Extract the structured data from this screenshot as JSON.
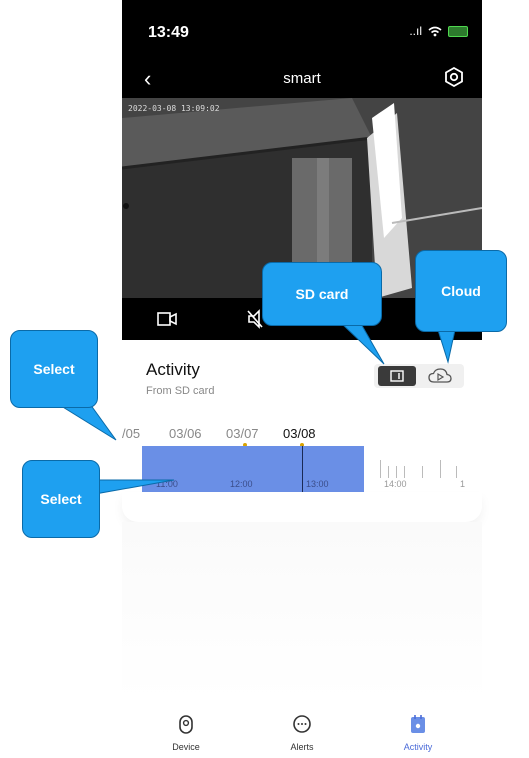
{
  "status_bar": {
    "time": "13:49",
    "signal": "..ıl"
  },
  "nav": {
    "title": "smart"
  },
  "video": {
    "timestamp": "2022-03-08 13:09:02"
  },
  "activity": {
    "title": "Activity",
    "subtitle": "From SD card"
  },
  "dates": [
    "/05",
    "03/06",
    "03/07",
    "03/08"
  ],
  "timeline": {
    "labels": [
      "11:00",
      "12:00",
      "13:00",
      "14:00",
      "1"
    ]
  },
  "tabs": [
    {
      "label": "Device",
      "icon": "camera-device-icon"
    },
    {
      "label": "Alerts",
      "icon": "chat-bubble-icon"
    },
    {
      "label": "Activity",
      "icon": "activity-icon"
    }
  ],
  "callouts": {
    "sd_card": "SD card",
    "cloud": "Cloud",
    "select_top": "Select",
    "select_bottom": "Select"
  },
  "colors": {
    "accent": "#6a8fe6",
    "callout": "#1ea0f0",
    "date_marker": "#d9a300",
    "status_bg": "#000000"
  }
}
